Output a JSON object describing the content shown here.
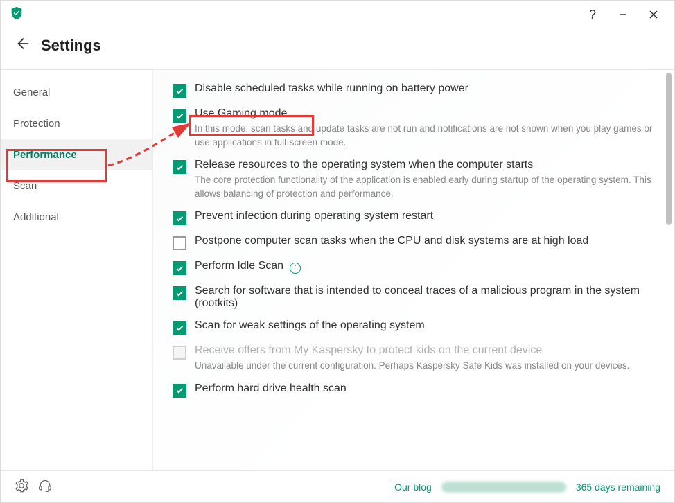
{
  "window": {
    "help_tooltip": "Help",
    "minimize_tooltip": "Minimize",
    "close_tooltip": "Close"
  },
  "header": {
    "title": "Settings"
  },
  "sidebar": {
    "items": [
      {
        "label": "General"
      },
      {
        "label": "Protection"
      },
      {
        "label": "Performance",
        "active": true
      },
      {
        "label": "Scan"
      },
      {
        "label": "Additional"
      }
    ]
  },
  "settings": [
    {
      "checked": true,
      "label": "Disable scheduled tasks while running on battery power"
    },
    {
      "checked": true,
      "label": "Use Gaming mode",
      "desc": "In this mode, scan tasks and update tasks are not run and notifications are not shown when you play games or use applications in full-screen mode.",
      "highlighted": true
    },
    {
      "checked": true,
      "label": "Release resources to the operating system when the computer starts",
      "desc": "The core protection functionality of the application is enabled early during startup of the operating system. This allows balancing of protection and performance."
    },
    {
      "checked": true,
      "label": "Prevent infection during operating system restart"
    },
    {
      "checked": false,
      "label": "Postpone computer scan tasks when the CPU and disk systems are at high load"
    },
    {
      "checked": true,
      "label": "Perform Idle Scan",
      "info": true
    },
    {
      "checked": true,
      "label": "Search for software that is intended to conceal traces of a malicious program in the system (rootkits)"
    },
    {
      "checked": true,
      "label": "Scan for weak settings of the operating system"
    },
    {
      "disabled": true,
      "label": "Receive offers from My Kaspersky to protect kids on the current device",
      "desc": "Unavailable under the current configuration. Perhaps Kaspersky Safe Kids was installed on your devices."
    },
    {
      "checked": true,
      "label": "Perform hard drive health scan"
    }
  ],
  "footer": {
    "blog_link": "Our blog",
    "days_remaining": "365 days remaining"
  },
  "annotation": {
    "source": "Performance sidebar item",
    "target": "Use Gaming mode checkbox"
  }
}
